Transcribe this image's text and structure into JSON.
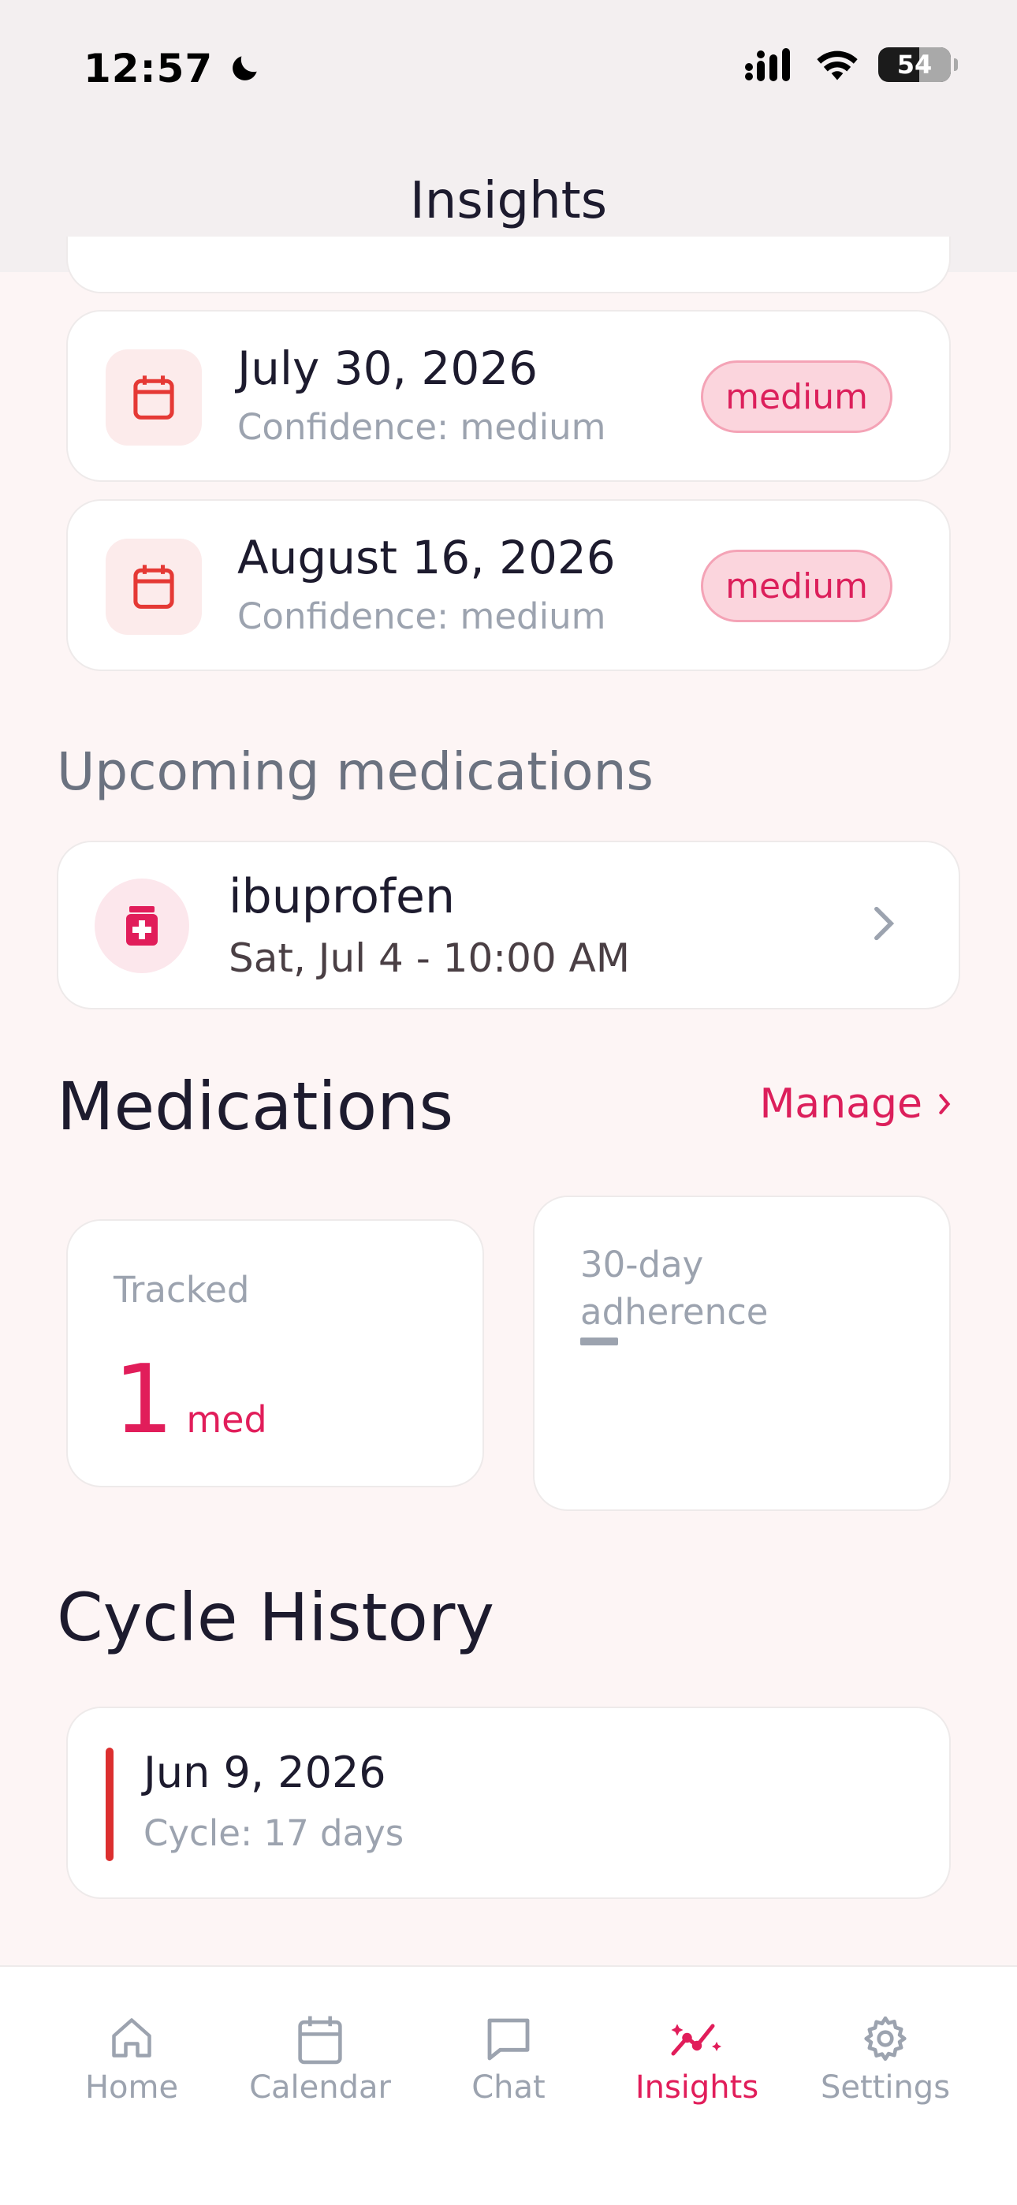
{
  "status_bar": {
    "time": "12:57",
    "battery": "54"
  },
  "header": {
    "title": "Insights"
  },
  "predictions": [
    {
      "date": "July 30, 2026",
      "confidence": "Confidence: medium",
      "badge": "medium"
    },
    {
      "date": "August 16, 2026",
      "confidence": "Confidence: medium",
      "badge": "medium"
    }
  ],
  "upcoming": {
    "title": "Upcoming medications",
    "items": [
      {
        "name": "ibuprofen",
        "time": "Sat, Jul 4 - 10:00 AM"
      }
    ]
  },
  "medications": {
    "title": "Medications",
    "manage_label": "Manage",
    "tracked_label": "Tracked",
    "tracked_value": "1",
    "tracked_unit": "med",
    "adherence_label_line1": "30-day",
    "adherence_label_line2": "adherence",
    "adherence_value": "—"
  },
  "cycle_history": {
    "title": "Cycle History",
    "items": [
      {
        "date": "Jun 9, 2026",
        "cycle": "Cycle: 17 days"
      }
    ]
  },
  "tabs": [
    {
      "label": "Home",
      "icon": "home-icon"
    },
    {
      "label": "Calendar",
      "icon": "calendar-icon"
    },
    {
      "label": "Chat",
      "icon": "chat-icon"
    },
    {
      "label": "Insights",
      "icon": "insights-icon",
      "active": true
    },
    {
      "label": "Settings",
      "icon": "gear-icon"
    }
  ],
  "colors": {
    "accent": "#e11d5a",
    "background": "#fdf5f5",
    "badge_bg": "#fbd5dd",
    "history_bar": "#dc2f2f"
  }
}
